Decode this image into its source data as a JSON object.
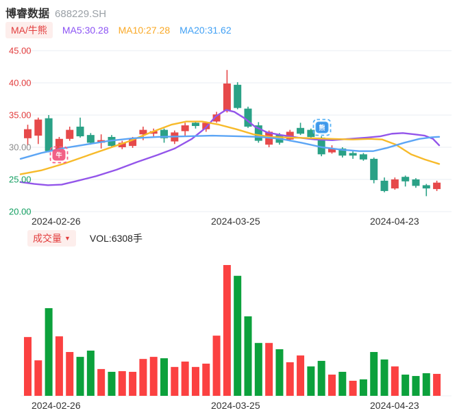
{
  "header": {
    "title": "博睿数据",
    "code": "688229.SH"
  },
  "indicators": {
    "badge_label": "MA/牛熊",
    "badge_color": "#e23c3c",
    "badge_bg": "#fdeeec",
    "ma5_label": "MA5:30.28",
    "ma5_color": "#8b52f4",
    "ma10_label": "MA10:27.28",
    "ma10_color": "#f9a825",
    "ma20_label": "MA20:31.62",
    "ma20_color": "#41a0f4"
  },
  "volume_header": {
    "badge_label": "成交量",
    "dropdown_glyph": "▼",
    "badge_color": "#e23c3c",
    "value_label": "VOL:6308手"
  },
  "xaxis": {
    "labels": [
      "2024-02-26",
      "2024-03-25",
      "2024-04-23"
    ],
    "positions": [
      46,
      308,
      540
    ]
  },
  "chart_data": [
    {
      "type": "candlestick",
      "title": "博睿数据 688229.SH daily K-line",
      "ylim": [
        20,
        45
      ],
      "grid": true,
      "yticks": [
        {
          "label": "45.00",
          "value": 45,
          "color": "#e23b3b"
        },
        {
          "label": "40.00",
          "value": 40,
          "color": "#e23b3b"
        },
        {
          "label": "35.00",
          "value": 35,
          "color": "#e23b3b"
        },
        {
          "label": "30.00",
          "value": 30,
          "color": "#8c8c8c"
        },
        {
          "label": "25.00",
          "value": 25,
          "color": "#129e60"
        },
        {
          "label": "20.00",
          "value": 20,
          "color": "#129e60"
        }
      ],
      "up_color": "#e6494a",
      "down_color": "#2aa186",
      "candles": [
        [
          31.4,
          32.8,
          33.5,
          30.3,
          "r"
        ],
        [
          31.8,
          34.3,
          34.6,
          30.5,
          "r"
        ],
        [
          34.5,
          29.4,
          35.0,
          29.2,
          "g"
        ],
        [
          29.6,
          31.3,
          31.6,
          29.0,
          "r"
        ],
        [
          31.3,
          32.7,
          33.2,
          31.0,
          "r"
        ],
        [
          33.2,
          31.7,
          34.6,
          31.5,
          "g"
        ],
        [
          31.9,
          30.7,
          32.2,
          30.4,
          "g"
        ],
        [
          30.7,
          31.1,
          32.0,
          29.8,
          "r"
        ],
        [
          31.6,
          30.2,
          31.9,
          30.0,
          "g"
        ],
        [
          30.0,
          30.7,
          31.0,
          29.7,
          "r"
        ],
        [
          30.2,
          31.3,
          31.6,
          29.9,
          "r"
        ],
        [
          32.0,
          32.7,
          33.2,
          31.1,
          "r"
        ],
        [
          32.1,
          32.5,
          32.9,
          31.7,
          "r"
        ],
        [
          32.7,
          31.4,
          32.9,
          30.7,
          "g"
        ],
        [
          30.9,
          32.3,
          32.6,
          30.5,
          "r"
        ],
        [
          32.5,
          33.4,
          33.8,
          31.8,
          "r"
        ],
        [
          33.8,
          33.3,
          34.0,
          32.9,
          "g"
        ],
        [
          32.8,
          33.8,
          34.0,
          32.4,
          "r"
        ],
        [
          34.0,
          35.1,
          35.5,
          33.8,
          "r"
        ],
        [
          35.6,
          39.9,
          42.0,
          35.4,
          "r"
        ],
        [
          39.7,
          36.1,
          40.1,
          35.9,
          "g"
        ],
        [
          36.0,
          33.2,
          36.3,
          33.0,
          "g"
        ],
        [
          33.4,
          31.0,
          33.9,
          30.7,
          "g"
        ],
        [
          30.4,
          32.4,
          32.6,
          30.0,
          "r"
        ],
        [
          31.9,
          30.7,
          32.2,
          30.4,
          "g"
        ],
        [
          31.2,
          32.4,
          32.7,
          30.9,
          "r"
        ],
        [
          33.0,
          32.1,
          33.8,
          31.9,
          "g"
        ],
        [
          32.7,
          31.6,
          32.9,
          31.3,
          "g"
        ],
        [
          31.5,
          28.9,
          31.7,
          28.6,
          "g"
        ],
        [
          29.2,
          29.8,
          30.3,
          29.0,
          "r"
        ],
        [
          29.8,
          28.7,
          30.0,
          28.4,
          "g"
        ],
        [
          29.1,
          28.7,
          29.5,
          28.2,
          "g"
        ],
        [
          28.9,
          28.1,
          29.1,
          27.9,
          "g"
        ],
        [
          28.2,
          24.9,
          28.4,
          24.4,
          "g"
        ],
        [
          24.8,
          23.2,
          25.3,
          23.0,
          "g"
        ],
        [
          23.6,
          25.0,
          25.3,
          23.4,
          "r"
        ],
        [
          25.4,
          24.7,
          25.6,
          23.9,
          "g"
        ],
        [
          25.0,
          24.0,
          25.2,
          23.7,
          "g"
        ],
        [
          24.1,
          23.6,
          24.3,
          22.4,
          "g"
        ],
        [
          23.5,
          24.5,
          24.8,
          23.2,
          "r"
        ]
      ],
      "series": [
        {
          "name": "MA5",
          "color": "#9355ea",
          "points": [
            [
              30,
              24.6
            ],
            [
              50,
              24.3
            ],
            [
              70,
              24.1
            ],
            [
              90,
              24.2
            ],
            [
              110,
              24.7
            ],
            [
              140,
              25.5
            ],
            [
              170,
              26.5
            ],
            [
              200,
              27.7
            ],
            [
              230,
              28.8
            ],
            [
              255,
              29.8
            ],
            [
              280,
              31.3
            ],
            [
              300,
              33.0
            ],
            [
              315,
              34.8
            ],
            [
              330,
              35.8
            ],
            [
              342,
              35.5
            ],
            [
              357,
              34.5
            ],
            [
              372,
              33.2
            ],
            [
              390,
              32.3
            ],
            [
              410,
              31.9
            ],
            [
              435,
              31.5
            ],
            [
              460,
              31.2
            ],
            [
              485,
              31.1
            ],
            [
              510,
              31.3
            ],
            [
              535,
              31.5
            ],
            [
              555,
              31.7
            ],
            [
              572,
              32.1
            ],
            [
              588,
              32.2
            ],
            [
              605,
              32.0
            ],
            [
              620,
              31.8
            ],
            [
              632,
              31.3
            ],
            [
              641,
              30.3
            ]
          ]
        },
        {
          "name": "MA10",
          "color": "#f7ba2a",
          "points": [
            [
              30,
              25.8
            ],
            [
              60,
              26.4
            ],
            [
              95,
              27.5
            ],
            [
              130,
              28.8
            ],
            [
              160,
              29.9
            ],
            [
              190,
              31.0
            ],
            [
              220,
              32.3
            ],
            [
              250,
              33.5
            ],
            [
              272,
              34.0
            ],
            [
              295,
              34.0
            ],
            [
              320,
              33.5
            ],
            [
              345,
              32.8
            ],
            [
              370,
              32.0
            ],
            [
              395,
              31.6
            ],
            [
              425,
              31.5
            ],
            [
              455,
              31.4
            ],
            [
              485,
              31.3
            ],
            [
              515,
              31.2
            ],
            [
              540,
              31.3
            ],
            [
              558,
              31.2
            ],
            [
              578,
              30.4
            ],
            [
              600,
              28.9
            ],
            [
              620,
              28.1
            ],
            [
              641,
              27.4
            ]
          ]
        },
        {
          "name": "MA20",
          "color": "#5ca5f5",
          "points": [
            [
              30,
              28.2
            ],
            [
              60,
              29.1
            ],
            [
              95,
              29.9
            ],
            [
              130,
              30.5
            ],
            [
              160,
              31.0
            ],
            [
              195,
              31.4
            ],
            [
              230,
              31.6
            ],
            [
              270,
              31.7
            ],
            [
              310,
              31.8
            ],
            [
              350,
              31.7
            ],
            [
              380,
              31.6
            ],
            [
              410,
              31.3
            ],
            [
              440,
              30.7
            ],
            [
              470,
              30.0
            ],
            [
              500,
              29.6
            ],
            [
              525,
              29.4
            ],
            [
              545,
              29.4
            ],
            [
              565,
              29.9
            ],
            [
              590,
              30.7
            ],
            [
              612,
              31.3
            ],
            [
              630,
              31.55
            ],
            [
              641,
              31.62
            ]
          ]
        }
      ],
      "markers": [
        {
          "kind": "bull",
          "glyph": "牛",
          "x": 86,
          "y": 226,
          "fill": "#f0527c",
          "bracket": "#f75d87"
        },
        {
          "kind": "bear",
          "glyph": "熊",
          "x": 470,
          "y": 186,
          "fill": "#2f8fe8",
          "bracket": "#56b2f7"
        }
      ]
    },
    {
      "type": "bar",
      "title": "成交量 (手)",
      "ylabel": "VOL",
      "unit": "手",
      "scale_max": 37600,
      "up_color": "#fb4141",
      "down_color": "#0ca13c",
      "values": [
        16900,
        10200,
        25200,
        17100,
        12600,
        11200,
        13000,
        7700,
        6900,
        7100,
        6900,
        10600,
        11200,
        10800,
        8300,
        9850,
        8300,
        9250,
        17300,
        37600,
        34500,
        22850,
        15200,
        15200,
        13400,
        9650,
        11600,
        8450,
        10050,
        6100,
        6900,
        4330,
        4730,
        12600,
        10450,
        8450,
        6100,
        5700,
        6500,
        6308
      ],
      "colors": [
        "r",
        "r",
        "g",
        "r",
        "r",
        "g",
        "g",
        "r",
        "g",
        "r",
        "r",
        "r",
        "r",
        "g",
        "r",
        "r",
        "r",
        "r",
        "r",
        "r",
        "g",
        "g",
        "g",
        "r",
        "g",
        "r",
        "r",
        "g",
        "g",
        "r",
        "g",
        "r",
        "g",
        "g",
        "g",
        "r",
        "g",
        "g",
        "g",
        "r"
      ]
    }
  ]
}
